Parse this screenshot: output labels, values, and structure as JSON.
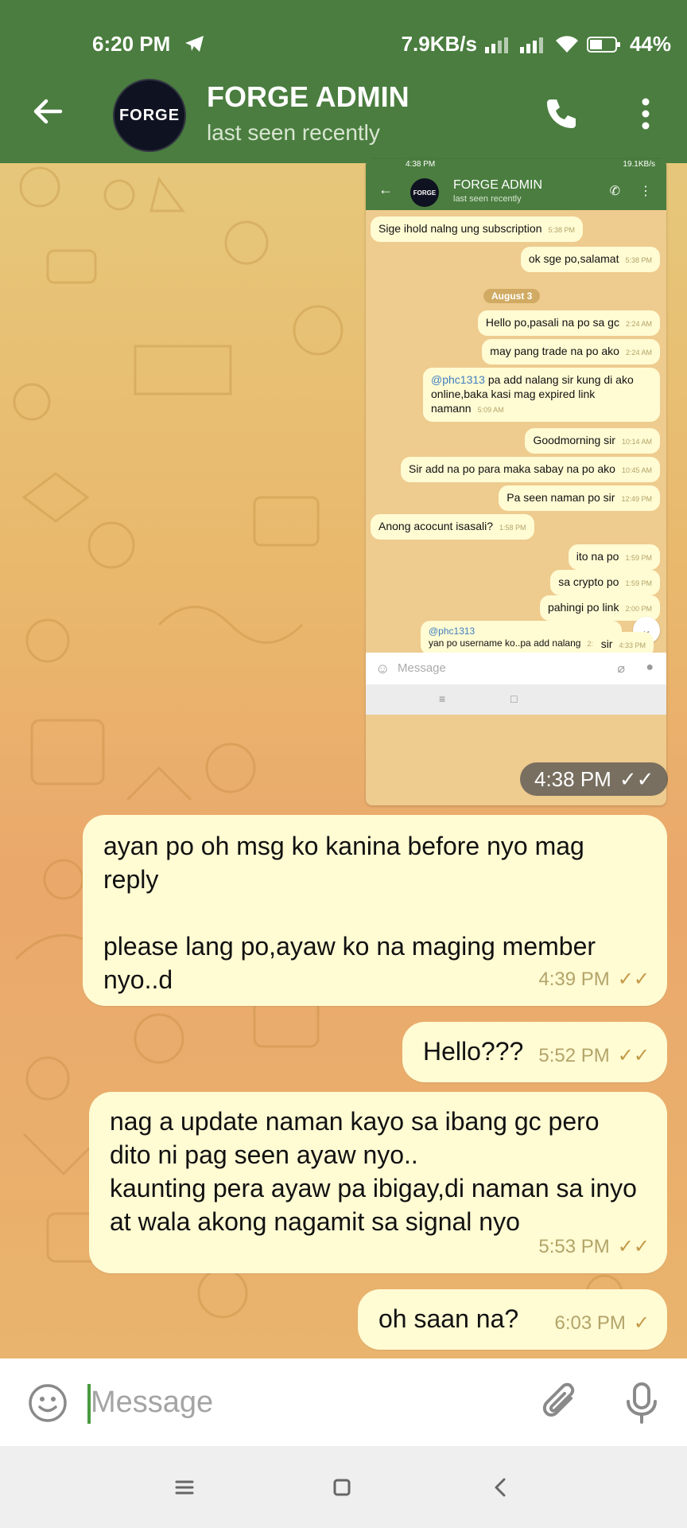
{
  "status_bar": {
    "time": "6:20 PM",
    "network_speed": "7.9KB/s",
    "battery": "44%"
  },
  "chat_header": {
    "title": "FORGE ADMIN",
    "subtitle": "last seen recently",
    "avatar_text": "FORGE"
  },
  "embedded_screenshot": {
    "status_time": "4:38 PM",
    "status_speed": "19.1KB/s",
    "title": "FORGE ADMIN",
    "subtitle": "last seen recently",
    "date_separator": "August 3",
    "messages": [
      {
        "text": "Sige ihold nalng ung subscription",
        "time": "5:38 PM"
      },
      {
        "text": "ok sge po,salamat",
        "time": "5:38 PM"
      },
      {
        "text": "Hello po,pasali na po sa gc",
        "time": "2:24 AM"
      },
      {
        "text": "may pang trade na po ako",
        "time": "2:24 AM"
      },
      {
        "mention": "@phc1313",
        "text": " pa add nalang sir kung di ako online,baka kasi mag expired link namann",
        "time": "5:09 AM"
      },
      {
        "text": "Goodmorning sir",
        "time": "10:14 AM"
      },
      {
        "text": "Sir add na po para maka sabay na po ako",
        "time": "10:45 AM"
      },
      {
        "text": "Pa seen naman po sir",
        "time": "12:49 PM"
      },
      {
        "text": "Anong acocunt isasali?",
        "time": "1:58 PM"
      },
      {
        "text": "ito na po",
        "time": "1:59 PM"
      },
      {
        "text": "sa crypto po",
        "time": "1:59 PM"
      },
      {
        "text": "pahingi po link",
        "time": "2:00 PM"
      },
      {
        "mention": "@phc1313",
        "text": "\nyan po username ko..pa add nalang",
        "time": "2:05 PM"
      },
      {
        "text": "sir",
        "time": "4:33 PM"
      }
    ],
    "input_placeholder": "Message",
    "sent_time": "4:38 PM"
  },
  "messages": [
    {
      "text": "ayan po oh msg ko kanina before nyo mag reply\n\nplease lang po,ayaw ko na maging member nyo..d",
      "time": "4:39 PM",
      "ticks": "✓✓"
    },
    {
      "text": "Hello???",
      "time": "5:52 PM",
      "ticks": "✓✓"
    },
    {
      "text": "nag a update naman kayo sa ibang gc pero dito ni pag seen ayaw nyo..\nkaunting pera ayaw pa ibigay,di naman sa inyo at wala akong nagamit sa signal nyo",
      "time": "5:53 PM",
      "ticks": "✓✓"
    },
    {
      "text": "oh saan na?",
      "time": "6:03 PM",
      "ticks": "✓"
    }
  ],
  "input": {
    "placeholder": "Message"
  },
  "colors": {
    "header": "#4a7d3f",
    "bubble": "#fffbd3",
    "accent": "#4a9a3f"
  },
  "icons": [
    "back-arrow-icon",
    "phone-icon",
    "more-vert-icon",
    "emoji-icon",
    "attach-icon",
    "mic-icon",
    "menu-icon",
    "home-icon",
    "back-nav-icon"
  ]
}
